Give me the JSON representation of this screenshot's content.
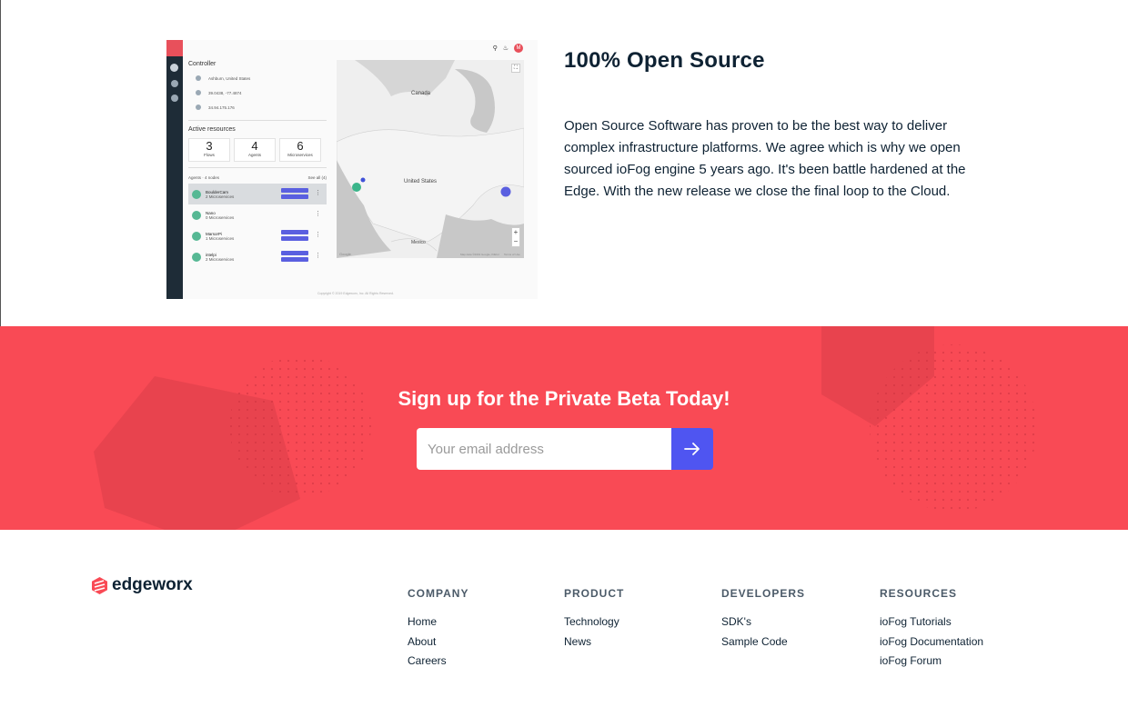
{
  "feature": {
    "title": "100% Open Source",
    "body": "Open Source Software has proven to be the best way to deliver complex infrastructure platforms. We agree which is why we open sourced ioFog engine 5 years ago. It's been battle hardened at the Edge. With the new release we close the final loop to the Cloud."
  },
  "screenshot": {
    "controller_heading": "Controller",
    "location": "Ashburn, United States",
    "coordinates": "39.0438, -77.4874",
    "ip": "34.94.175.176",
    "active_resources_heading": "Active resources",
    "stats": [
      {
        "value": "3",
        "label": "Flows"
      },
      {
        "value": "4",
        "label": "Agents"
      },
      {
        "value": "6",
        "label": "Microservices"
      }
    ],
    "agents_heading": "Agents · 4 nodes",
    "see_all": "See all (4)",
    "agents": [
      {
        "name": "BoulderCam",
        "sub": "2 Microservices"
      },
      {
        "name": "Nano",
        "sub": "0 Microservices"
      },
      {
        "name": "MarsorPi",
        "sub": "1 Microservices"
      },
      {
        "name": "intelpi",
        "sub": "2 Microservices"
      }
    ],
    "avatar_letter": "M",
    "copyright": "Copyright © 2019 Edgeworx, Inc. All Rights Reserved.",
    "map": {
      "labels": [
        "Canada",
        "United States",
        "Mexico"
      ],
      "google": "Google",
      "map_data": "Map data ©2019 Google, INEGI",
      "terms": "Terms of Use"
    },
    "icons": [
      "search-icon",
      "bell-icon",
      "avatar-icon",
      "zoom-in-icon",
      "zoom-out-icon",
      "fullscreen-icon"
    ]
  },
  "signup": {
    "title": "Sign up for the Private Beta Today!",
    "email_placeholder": "Your email address",
    "submit_icon": "arrow-right-icon"
  },
  "footer": {
    "brand": "edgeworx",
    "columns": [
      {
        "heading": "COMPANY",
        "links": [
          "Home",
          "About",
          "Careers"
        ]
      },
      {
        "heading": "PRODUCT",
        "links": [
          "Technology",
          "News"
        ]
      },
      {
        "heading": "DEVELOPERS",
        "links": [
          "SDK's",
          "Sample Code"
        ]
      },
      {
        "heading": "RESOURCES",
        "links": [
          "ioFog Tutorials",
          "ioFog Documentation",
          "ioFog Forum"
        ]
      }
    ]
  },
  "colors": {
    "accent_red": "#f94a55",
    "button_blue": "#4f55f1",
    "text_dark": "#0e2233",
    "brand_red": "#e8505b"
  }
}
